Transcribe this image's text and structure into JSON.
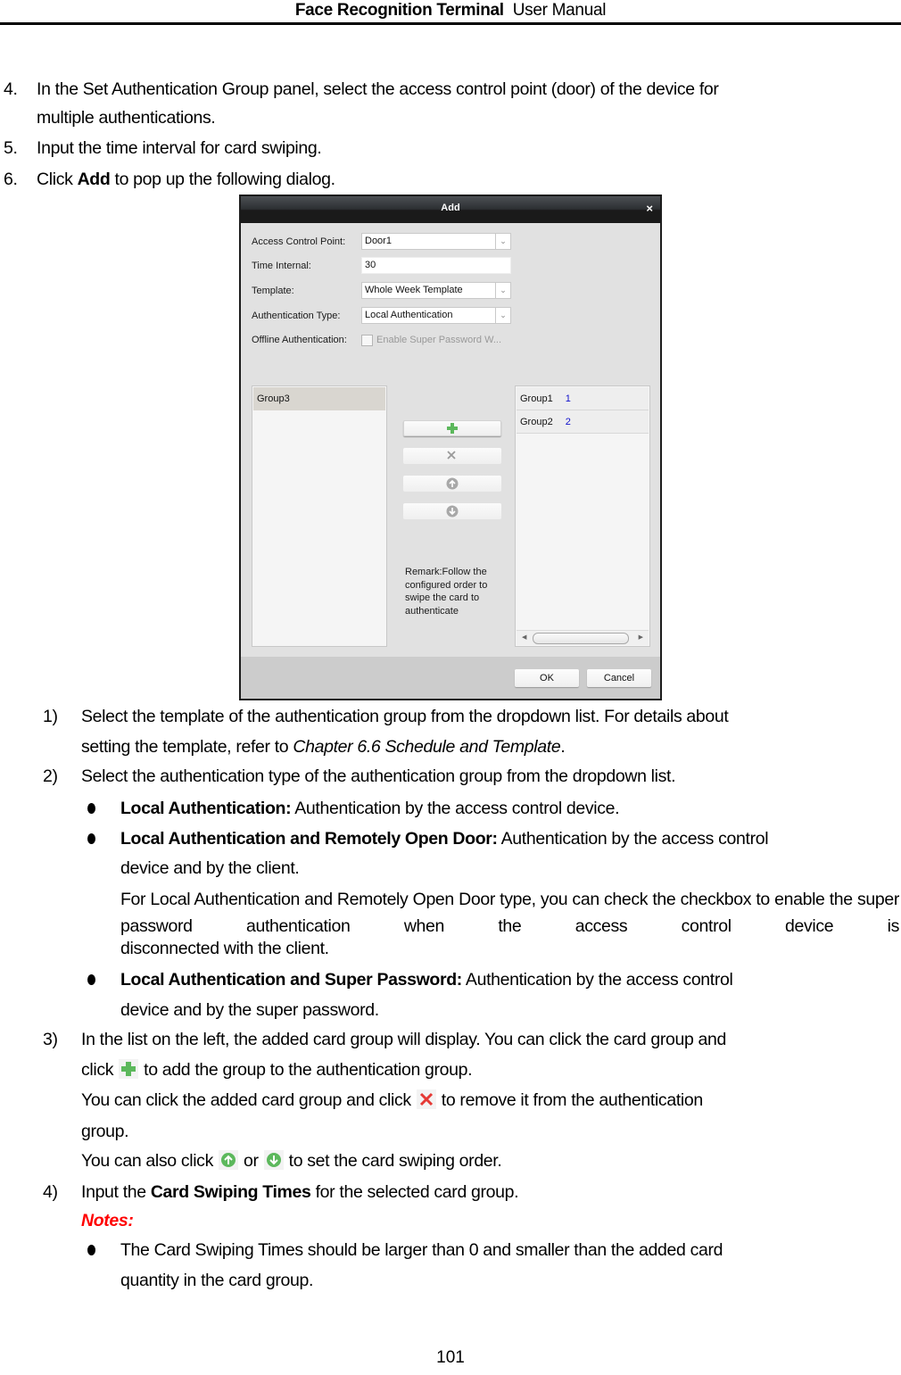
{
  "header": {
    "title_bold": "Face Recognition Terminal",
    "title_rest": "User Manual"
  },
  "steps_top": [
    {
      "num": "4.",
      "lines": [
        "In the Set Authentication Group panel, select the access control point (door) of the device for",
        "multiple authentications."
      ]
    },
    {
      "num": "5.",
      "lines": [
        "Input the time interval for card swiping."
      ]
    },
    {
      "num": "6.",
      "pre": "Click ",
      "bold": "Add",
      "post": " to pop up the following dialog."
    }
  ],
  "dialog": {
    "title": "Add",
    "close_label": "×",
    "fields": {
      "access_control_point": {
        "label": "Access Control Point:",
        "value": "Door1"
      },
      "time_internal": {
        "label": "Time Internal:",
        "value": "30"
      },
      "template": {
        "label": "Template:",
        "value": "Whole Week Template"
      },
      "authentication_type": {
        "label": "Authentication Type:",
        "value": "Local Authentication"
      },
      "offline_authentication": {
        "label": "Offline Authentication:",
        "checkbox_label": "Enable Super Password W...",
        "checked": false
      }
    },
    "left_list": [
      {
        "name": "Group3"
      }
    ],
    "right_list": [
      {
        "name": "Group1",
        "count": "1"
      },
      {
        "name": "Group2",
        "count": "2"
      }
    ],
    "remark": "Remark:Follow the configured order to swipe the card to authenticate",
    "ok_label": "OK",
    "cancel_label": "Cancel"
  },
  "substeps": {
    "s1": {
      "num": "1)",
      "line1": "Select the template of the authentication group from the dropdown list. For details about",
      "line2_pre": "setting the template, refer to ",
      "line2_italic": "Chapter 6.6 Schedule and Template",
      "line2_post": "."
    },
    "s2": {
      "num": "2)",
      "text": "Select the authentication type of the authentication group from the dropdown list."
    },
    "b1": {
      "bold": "Local Authentication:",
      "text": " Authentication by the access control device."
    },
    "b2": {
      "bold": "Local Authentication and Remotely Open Door:",
      "text": " Authentication by the access control",
      "line2": "device and by the client.",
      "para": "For Local Authentication and Remotely Open Door type, you can check the checkbox to enable the super password authentication when the access control device is",
      "para_last": "disconnected with the client."
    },
    "b3": {
      "bold": "Local Authentication and Super Password:",
      "text": " Authentication by the access control",
      "line2": "device and by the super password."
    },
    "s3": {
      "num": "3)",
      "line1": "In the list on the left, the added card group will display. You can click the card group and",
      "line2_pre": "click",
      "line2_post": "to add the group to the authentication group.",
      "line3_pre": "You can click the added card group and click",
      "line3_post": "to remove it from the authentication",
      "line4": "group.",
      "line5_pre": "You can also click",
      "line5_mid": "or",
      "line5_post": "to set the card swiping order."
    },
    "s4": {
      "num": "4)",
      "pre": "Input the ",
      "bold": "Card Swiping Times",
      "post": " for the selected card group."
    },
    "notes_label": "Notes:",
    "note1": {
      "line1": "The Card Swiping Times should be larger than 0 and smaller than the added card",
      "line2": "quantity in the card group."
    }
  },
  "icons": {
    "add": "plus-icon",
    "remove": "x-icon",
    "up": "arrow-up-circle-icon",
    "down": "arrow-down-circle-icon"
  },
  "colors": {
    "add_green": "#5cb85c",
    "remove_red": "#e53935",
    "notes_red": "#ff0000",
    "count_blue": "#1010cc"
  },
  "page_number": "101"
}
